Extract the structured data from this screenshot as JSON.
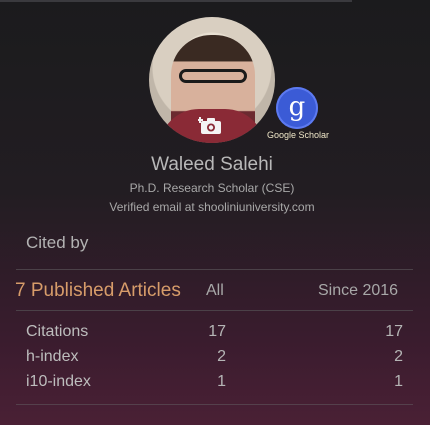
{
  "profile": {
    "name": "Waleed Salehi",
    "role": "Ph.D. Research Scholar (CSE)",
    "email": "Verified email at shooliniuniversity.com",
    "scholar_label": "Google Scholar",
    "scholar_glyph": "g"
  },
  "stats": {
    "section_title": "Cited by",
    "articles_title": "7 Published Articles",
    "col_all": "All",
    "col_since": "Since 2016",
    "rows": [
      {
        "label": "Citations",
        "all": "17",
        "since": "17"
      },
      {
        "label": "h-index",
        "all": "2",
        "since": "2"
      },
      {
        "label": "i10-index",
        "all": "1",
        "since": "1"
      }
    ]
  },
  "icons": {
    "camera": "camera-plus-icon",
    "scholar": "google-scholar-icon"
  },
  "colors": {
    "accent": "#d79c6a",
    "scholar_blue": "#3b5bd6"
  }
}
